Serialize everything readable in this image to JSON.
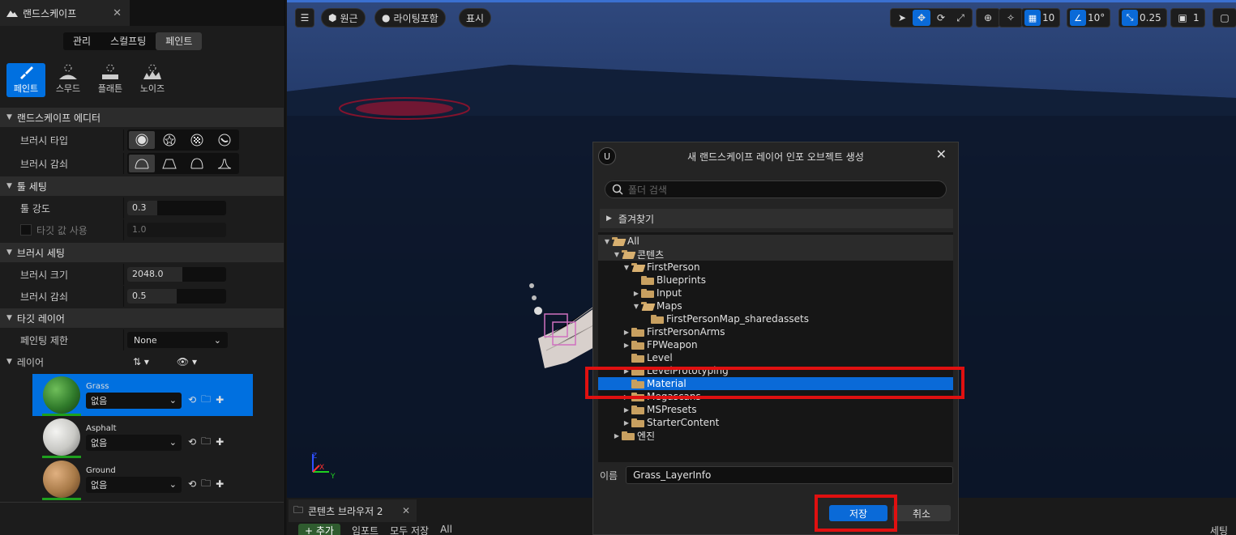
{
  "left_panel": {
    "tab_title": "랜드스케이프",
    "modes": [
      "관리",
      "스컬프팅",
      "페인트"
    ],
    "tools": [
      "페인트",
      "스무드",
      "플래튼",
      "노이즈"
    ],
    "sections": {
      "editor": "랜드스케이프 에디터",
      "tool_settings": "툴 세팅",
      "brush_settings": "브러시 세팅",
      "target_layers": "타깃 레이어"
    },
    "brush_type_label": "브러시 타입",
    "brush_falloff_label": "브러시 감쇠",
    "tool_strength_label": "툴 강도",
    "tool_strength_value": "0.3",
    "use_target_value_label": "타깃 값 사용",
    "target_value": "1.0",
    "brush_size_label": "브러시 크기",
    "brush_size_value": "2048.0",
    "brush_falloff2_label": "브러시 감쇠",
    "brush_falloff2_value": "0.5",
    "paint_restriction_label": "페인팅 제한",
    "paint_restriction_value": "None",
    "layers_label": "레이어",
    "layers": [
      {
        "name": "Grass",
        "info": "없음",
        "color": "#2f7a2a"
      },
      {
        "name": "Asphalt",
        "info": "없음",
        "color": "#d0d0cc"
      },
      {
        "name": "Ground",
        "info": "없음",
        "color": "#b08050"
      }
    ]
  },
  "viewport": {
    "perspective": "원근",
    "lighting": "라이팅포함",
    "show": "표시",
    "grid_snap": "10",
    "rotation_snap": "10°",
    "scale_snap": "0.25",
    "camera_speed": "1"
  },
  "content_browser": {
    "tab": "콘텐츠 브라우저 2",
    "add": "+ 추가",
    "import": "임포트",
    "save_all": "모두 저장",
    "path_all": "All",
    "settings": "세팅"
  },
  "dialog": {
    "title": "새 랜드스케이프 레이어 인포 오브젝트 생성",
    "search_placeholder": "폴더 검색",
    "favorites": "즐겨찾기",
    "tree": [
      {
        "label": "All",
        "depth": 0,
        "arrow": "open",
        "open": true
      },
      {
        "label": "콘텐츠",
        "depth": 1,
        "arrow": "open",
        "open": true
      },
      {
        "label": "FirstPerson",
        "depth": 2,
        "arrow": "open",
        "open": true
      },
      {
        "label": "Blueprints",
        "depth": 3,
        "arrow": "none",
        "open": false
      },
      {
        "label": "Input",
        "depth": 3,
        "arrow": "closed",
        "open": false
      },
      {
        "label": "Maps",
        "depth": 3,
        "arrow": "open",
        "open": true
      },
      {
        "label": "FirstPersonMap_sharedassets",
        "depth": 4,
        "arrow": "none",
        "open": false
      },
      {
        "label": "FirstPersonArms",
        "depth": 2,
        "arrow": "closed",
        "open": false
      },
      {
        "label": "FPWeapon",
        "depth": 2,
        "arrow": "closed",
        "open": false
      },
      {
        "label": "Level",
        "depth": 2,
        "arrow": "none",
        "open": false
      },
      {
        "label": "LevelPrototyping",
        "depth": 2,
        "arrow": "closed",
        "open": false
      },
      {
        "label": "Material",
        "depth": 2,
        "arrow": "none",
        "open": false,
        "selected": true
      },
      {
        "label": "Megascans",
        "depth": 2,
        "arrow": "closed",
        "open": false
      },
      {
        "label": "MSPresets",
        "depth": 2,
        "arrow": "closed",
        "open": false
      },
      {
        "label": "StarterContent",
        "depth": 2,
        "arrow": "closed",
        "open": false
      },
      {
        "label": "엔진",
        "depth": 1,
        "arrow": "closed",
        "open": false
      }
    ],
    "name_label": "이름",
    "name_value": "Grass_LayerInfo",
    "save": "저장",
    "cancel": "취소"
  },
  "accent_color": "#0a6ad8",
  "highlight_color": "#e01010"
}
